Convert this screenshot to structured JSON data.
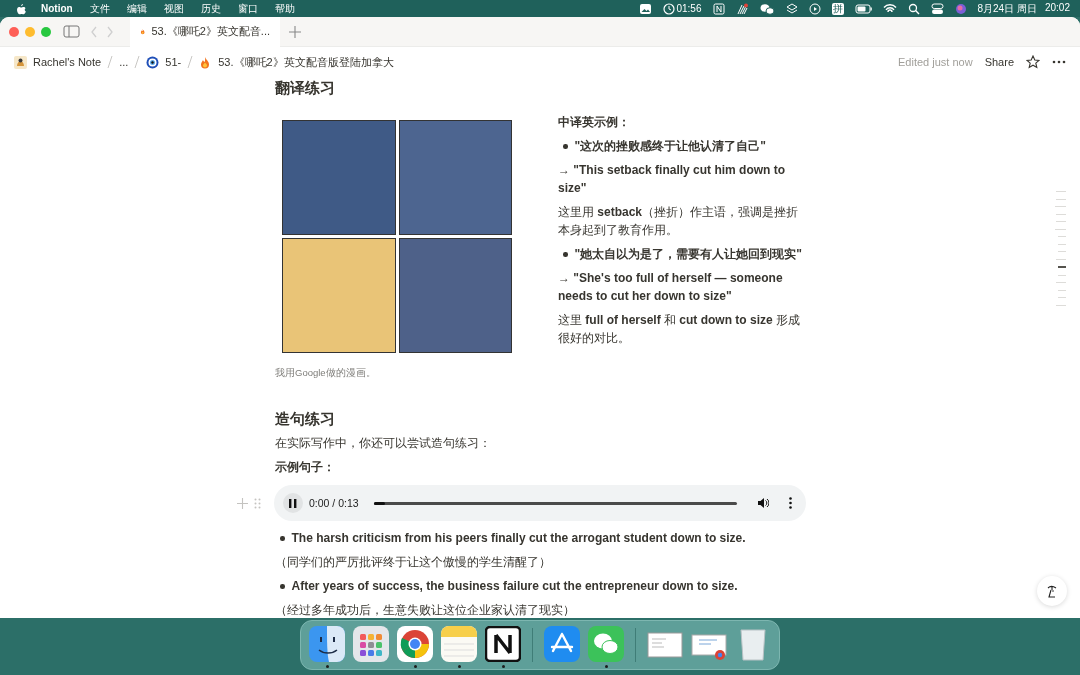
{
  "menu_bar": {
    "app": "Notion",
    "menus": [
      "文件",
      "编辑",
      "视图",
      "历史",
      "窗口",
      "帮助"
    ],
    "timer": "01:56",
    "input_method": "拼",
    "date": "8月24日 周日",
    "time": "20:02"
  },
  "tabs": [
    {
      "title": "53.《哪吒2》英文配音...",
      "selected": true
    }
  ],
  "breadcrumb": [
    {
      "label": "Rachel's Note"
    },
    {
      "label": "..."
    },
    {
      "label": "51-"
    },
    {
      "label": "53.《哪吒2》英文配音版登陆加拿大"
    }
  ],
  "header_actions": {
    "edited": "Edited just now",
    "share": "Share"
  },
  "translation": {
    "heading": "翻译练习",
    "caption": "我用Google做的漫画。",
    "blocks": [
      {
        "kind": "label",
        "text": "中译英示例："
      },
      {
        "kind": "bullet",
        "text": "\"这次的挫败感终于让他认清了自己\""
      },
      {
        "kind": "arrow",
        "text": "→ \"This setback finally cut him down to size\""
      },
      {
        "kind": "text",
        "text": "这里用 **setback**（挫折）作主语，强调是挫折本身起到了教育作用。"
      },
      {
        "kind": "bullet",
        "text": "\"她太自以为是了，需要有人让她回到现实\""
      },
      {
        "kind": "arrow",
        "text": "→ \"She's too full of herself — someone needs to cut her down to size\""
      },
      {
        "kind": "text",
        "text": "这里 **full of herself** 和 **cut down to size** 形成很好的对比。"
      }
    ]
  },
  "practice": {
    "heading": "造句练习",
    "intro": "在实际写作中，你还可以尝试造句练习：",
    "label": "示例句子：",
    "audio": {
      "time": "0:00 / 0:13",
      "playing": true,
      "level": 0.03
    },
    "blocks": [
      {
        "kind": "bullet",
        "text": "The harsh criticism from his peers finally cut the arrogant student down to size."
      },
      {
        "kind": "text",
        "text": "（同学们的严厉批评终于让这个傲慢的学生清醒了）"
      },
      {
        "kind": "bullet",
        "text": "After years of success, the business failure cut the entrepreneur down to size."
      },
      {
        "kind": "text",
        "text": "（经过多年成功后，生意失败让这位企业家认清了现实）"
      }
    ]
  },
  "outline": [
    {
      "selected": false
    },
    {
      "selected": false
    },
    {
      "selected": false
    },
    {
      "selected": false
    },
    {
      "selected": false
    },
    {
      "selected": false
    },
    {
      "selected": false
    },
    {
      "selected": false
    },
    {
      "selected": false
    },
    {
      "selected": false
    },
    {
      "selected": true
    },
    {
      "selected": false
    },
    {
      "selected": false
    },
    {
      "selected": false
    },
    {
      "selected": false
    },
    {
      "selected": false
    }
  ],
  "dock": [
    {
      "kind": "finder",
      "running": true
    },
    {
      "kind": "launchpad",
      "running": false
    },
    {
      "kind": "chrome",
      "running": true
    },
    {
      "kind": "notes",
      "running": true
    },
    {
      "kind": "notion",
      "running": true
    },
    {
      "kind": "divider"
    },
    {
      "kind": "appstore",
      "running": false
    },
    {
      "kind": "wechat",
      "running": true
    },
    {
      "kind": "divider"
    },
    {
      "kind": "window",
      "running": false
    },
    {
      "kind": "window-chrome",
      "running": false
    },
    {
      "kind": "trash",
      "running": false
    }
  ]
}
